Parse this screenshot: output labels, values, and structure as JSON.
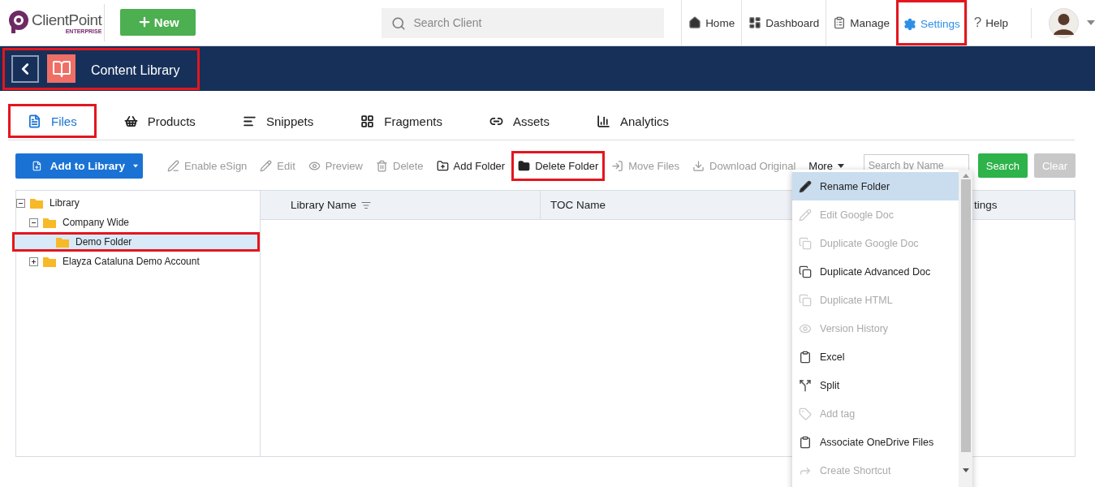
{
  "header": {
    "logo": {
      "name": "ClientPoint",
      "edition": "ENTERPRISE"
    },
    "new_button": "New",
    "search": {
      "placeholder": "Search Client"
    },
    "nav": [
      {
        "label": "Home",
        "kind": "home",
        "selected": false,
        "highlighted": false
      },
      {
        "label": "Dashboard",
        "kind": "dashboard",
        "selected": false,
        "highlighted": false
      },
      {
        "label": "Manage",
        "kind": "manage",
        "selected": false,
        "highlighted": false
      },
      {
        "label": "Settings",
        "kind": "settings",
        "selected": true,
        "highlighted": true
      },
      {
        "label": "Help",
        "kind": "help",
        "icon": "?",
        "selected": false,
        "highlighted": false
      }
    ]
  },
  "banner": {
    "title": "Content Library",
    "highlighted": true
  },
  "tabs": [
    {
      "label": "Files",
      "kind": "file",
      "selected": true,
      "highlighted": true
    },
    {
      "label": "Products",
      "kind": "basket",
      "selected": false,
      "highlighted": false
    },
    {
      "label": "Snippets",
      "kind": "lines",
      "selected": false,
      "highlighted": false
    },
    {
      "label": "Fragments",
      "kind": "grid",
      "selected": false,
      "highlighted": false
    },
    {
      "label": "Assets",
      "kind": "link",
      "selected": false,
      "highlighted": false
    },
    {
      "label": "Analytics",
      "kind": "chart",
      "selected": false,
      "highlighted": false
    }
  ],
  "toolbar": {
    "add_button": "Add to Library",
    "actions": [
      {
        "label": "Enable eSign",
        "kind": "sign",
        "disabled": true,
        "highlighted": false
      },
      {
        "label": "Edit",
        "kind": "pencil",
        "disabled": true,
        "highlighted": false
      },
      {
        "label": "Preview",
        "kind": "eye",
        "disabled": true,
        "highlighted": false
      },
      {
        "label": "Delete",
        "kind": "trash",
        "disabled": true,
        "highlighted": false
      },
      {
        "label": "Add Folder",
        "kind": "folder-plus",
        "disabled": false,
        "highlighted": false
      },
      {
        "label": "Delete Folder",
        "kind": "folder",
        "disabled": false,
        "highlighted": true
      },
      {
        "label": "Move Files",
        "kind": "move",
        "disabled": true,
        "highlighted": false
      },
      {
        "label": "Download Original",
        "kind": "download",
        "disabled": true,
        "highlighted": false
      }
    ],
    "more": "More",
    "search": {
      "placeholder": "Search by Name"
    },
    "search_button": "Search",
    "clear_button": {
      "label": "Clear",
      "disabled": true
    }
  },
  "tree": [
    {
      "label": "Library",
      "expanded": true,
      "selected": false,
      "highlighted": false,
      "children": [
        {
          "label": "Company Wide",
          "expanded": true,
          "selected": false,
          "highlighted": false,
          "children": [
            {
              "label": "Demo Folder",
              "selected": true,
              "highlighted": true
            }
          ]
        },
        {
          "label": "Elayza Cataluna Demo Account",
          "expanded": false,
          "selected": false,
          "highlighted": false
        }
      ]
    }
  ],
  "table": {
    "columns": [
      "Library Name",
      "TOC Name",
      "tings"
    ]
  },
  "more_menu": [
    {
      "label": "Rename Folder",
      "kind": "pencil",
      "disabled": false,
      "selected": true
    },
    {
      "label": "Edit Google Doc",
      "kind": "pencil",
      "disabled": true,
      "selected": false
    },
    {
      "label": "Duplicate Google Doc",
      "kind": "copy",
      "disabled": true,
      "selected": false
    },
    {
      "label": "Duplicate Advanced Doc",
      "kind": "copy",
      "disabled": false,
      "selected": false
    },
    {
      "label": "Duplicate HTML",
      "kind": "copy",
      "disabled": true,
      "selected": false
    },
    {
      "label": "Version History",
      "kind": "eye",
      "disabled": true,
      "selected": false
    },
    {
      "label": "Excel",
      "kind": "clipboard",
      "disabled": false,
      "selected": false
    },
    {
      "label": "Split",
      "kind": "split",
      "disabled": false,
      "selected": false
    },
    {
      "label": "Add tag",
      "kind": "tag",
      "disabled": true,
      "selected": false
    },
    {
      "label": "Associate OneDrive Files",
      "kind": "clipboard",
      "disabled": false,
      "selected": false
    },
    {
      "label": "Create Shortcut",
      "kind": "share",
      "disabled": true,
      "selected": false
    }
  ]
}
